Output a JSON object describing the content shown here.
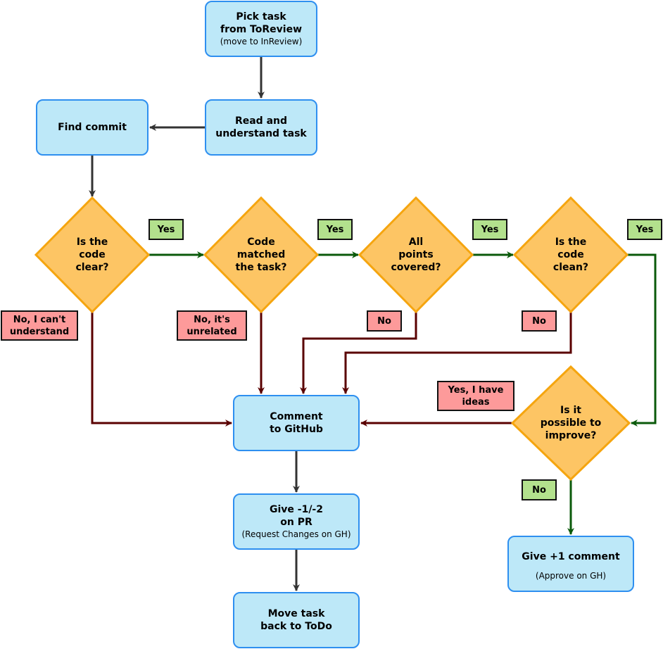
{
  "colors": {
    "process_fill": "#bde8f8",
    "process_border": "#2e8ff0",
    "decision_fill": "#fdc564",
    "decision_border": "#f5a50f",
    "yes_label": "#b3e18d",
    "no_label": "#fd9a9a",
    "flow_arrow": "#333333",
    "yes_arrow": "#0b5a0b",
    "no_arrow": "#5a0000"
  },
  "nodes": {
    "pick_task": {
      "title": "Pick task\nfrom ToReview",
      "subtitle": "(move to InReview)"
    },
    "read_task": {
      "title": "Read and\nunderstand task"
    },
    "find_commit": {
      "title": "Find commit"
    },
    "comment_github": {
      "title": "Comment\nto GitHub"
    },
    "give_minus": {
      "title": "Give -1/-2\non PR",
      "subtitle": "(Request Changes on GH)"
    },
    "move_back": {
      "title": "Move task\nback to ToDo"
    },
    "give_plus": {
      "title": "Give +1 comment",
      "subtitle": "(Approve on GH)"
    }
  },
  "decisions": {
    "code_clear": "Is the\ncode\nclear?",
    "code_matched": "Code\nmatched\nthe task?",
    "points_covered": "All\npoints\ncovered?",
    "code_clean": "Is the\ncode\nclean?",
    "possible_improve": "Is it\npossible to\nimprove?"
  },
  "labels": {
    "yes_clear": "Yes",
    "yes_matched": "Yes",
    "yes_covered": "Yes",
    "yes_clean": "Yes",
    "no_clear": "No, I can't\nunderstand",
    "no_matched": "No, it's\nunrelated",
    "no_covered": "No",
    "no_clean": "No",
    "yes_improve": "Yes, I have\nideas",
    "no_improve": "No"
  }
}
